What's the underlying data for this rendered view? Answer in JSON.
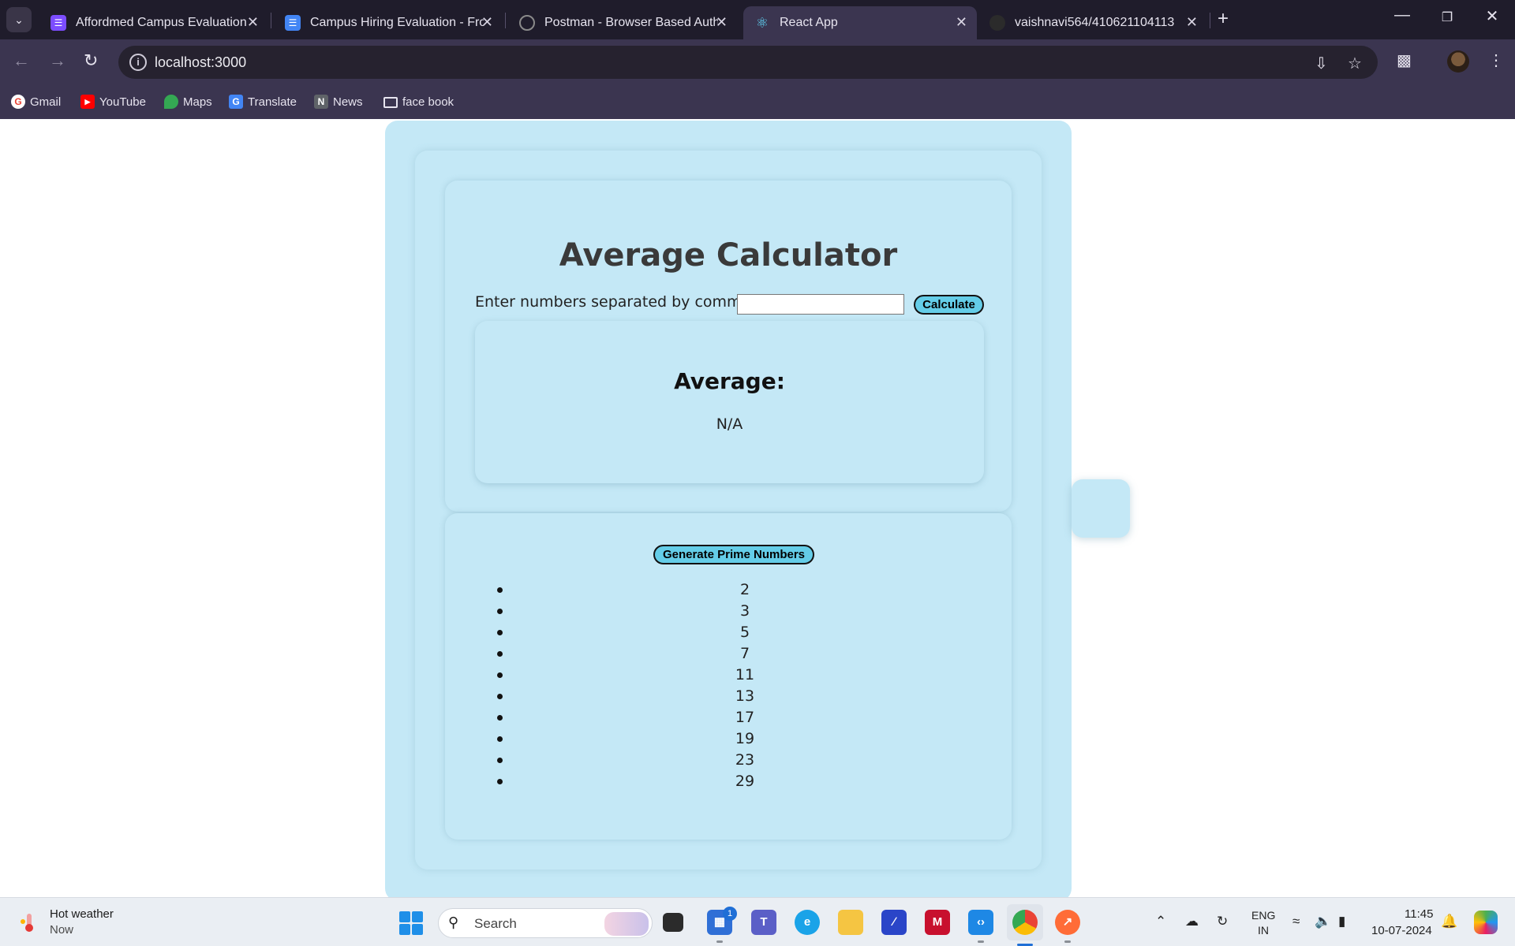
{
  "browser": {
    "tabs": [
      {
        "title": "Affordmed Campus Evaluation |",
        "icon": "forms-icon",
        "color": "#7c4dff"
      },
      {
        "title": "Campus Hiring Evaluation - Fro",
        "icon": "docs-icon",
        "color": "#4285f4"
      },
      {
        "title": "Postman - Browser Based Auth",
        "icon": "globe-icon",
        "color": "#8a8a8a"
      },
      {
        "title": "React App",
        "icon": "react-icon",
        "color": "#61dafb"
      },
      {
        "title": "vaishnavi564/410621104113",
        "icon": "github-icon",
        "color": "#2b2b2b"
      }
    ],
    "active_tab": 3,
    "url": "localhost:3000",
    "bookmarks": [
      {
        "label": "Gmail",
        "icon": "google-icon"
      },
      {
        "label": "YouTube",
        "icon": "youtube-icon"
      },
      {
        "label": "Maps",
        "icon": "maps-icon"
      },
      {
        "label": "Translate",
        "icon": "translate-icon"
      },
      {
        "label": "News",
        "icon": "news-icon"
      },
      {
        "label": "face book",
        "icon": "folder-icon"
      }
    ]
  },
  "app": {
    "title": "Average Calculator",
    "input_label": "Enter numbers separated by commas:",
    "input_value": "",
    "calculate_label": "Calculate",
    "result_heading": "Average:",
    "result_value": "N/A",
    "prime_button_label": "Generate Prime Numbers",
    "primes": [
      "2",
      "3",
      "5",
      "7",
      "11",
      "13",
      "17",
      "19",
      "23",
      "29"
    ],
    "bg_color": "#c4e8f6",
    "button_color": "#64cde8"
  },
  "taskbar": {
    "weather_title": "Hot weather",
    "weather_sub": "Now",
    "search_label": "Search",
    "store_badge": "1",
    "lang_top": "ENG",
    "lang_bottom": "IN",
    "time": "11:45",
    "date": "10-07-2024"
  }
}
